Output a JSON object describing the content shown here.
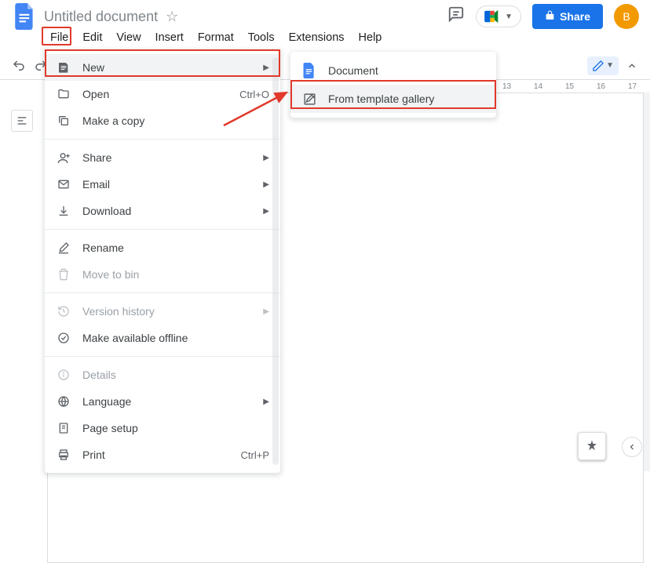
{
  "header": {
    "title": "Untitled document",
    "share_label": "Share",
    "avatar_letter": "B"
  },
  "menubar": {
    "items": [
      "File",
      "Edit",
      "View",
      "Insert",
      "Format",
      "Tools",
      "Extensions",
      "Help"
    ]
  },
  "ruler": {
    "labels": [
      "13",
      "14",
      "15",
      "16",
      "17"
    ]
  },
  "file_menu": {
    "new": "New",
    "open": "Open",
    "open_shortcut": "Ctrl+O",
    "make_copy": "Make a copy",
    "share": "Share",
    "email": "Email",
    "download": "Download",
    "rename": "Rename",
    "move_to_bin": "Move to bin",
    "version_history": "Version history",
    "offline": "Make available offline",
    "details": "Details",
    "language": "Language",
    "page_setup": "Page setup",
    "print": "Print",
    "print_shortcut": "Ctrl+P"
  },
  "new_submenu": {
    "document": "Document",
    "from_template": "From template gallery"
  }
}
